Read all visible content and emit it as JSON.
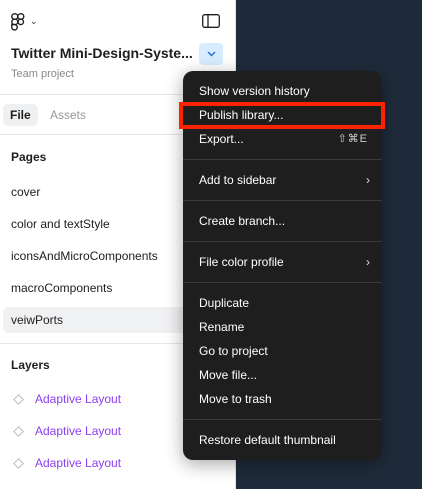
{
  "file": {
    "name": "Twitter Mini-Design-Syste...",
    "project": "Team project"
  },
  "tabs": [
    {
      "label": "File"
    },
    {
      "label": "Assets"
    }
  ],
  "pages": {
    "title": "Pages",
    "items": [
      {
        "label": "cover"
      },
      {
        "label": "color and textStyle"
      },
      {
        "label": "iconsAndMicroComponents"
      },
      {
        "label": "macroComponents"
      },
      {
        "label": "veiwPorts"
      }
    ]
  },
  "layers": {
    "title": "Layers",
    "items": [
      {
        "label": "Adaptive Layout"
      },
      {
        "label": "Adaptive Layout"
      },
      {
        "label": "Adaptive Layout"
      }
    ]
  },
  "menu": {
    "items": [
      {
        "label": "Show version history"
      },
      {
        "label": "Publish library..."
      },
      {
        "label": "Export...",
        "shortcut": "⇧⌘E"
      },
      {
        "label": "Add to sidebar",
        "arrow": "›"
      },
      {
        "label": "Create branch..."
      },
      {
        "label": "File color profile",
        "arrow": "›"
      },
      {
        "label": "Duplicate"
      },
      {
        "label": "Rename"
      },
      {
        "label": "Go to project"
      },
      {
        "label": "Move file..."
      },
      {
        "label": "Move to trash"
      },
      {
        "label": "Restore default thumbnail"
      }
    ]
  },
  "colors": {
    "canvas": "#1f2b3a",
    "menu_bg": "#1e1e1e",
    "highlight": "#ff2200",
    "layer_text": "#8b3ff0",
    "dropdown_bg": "#d7ecff"
  }
}
